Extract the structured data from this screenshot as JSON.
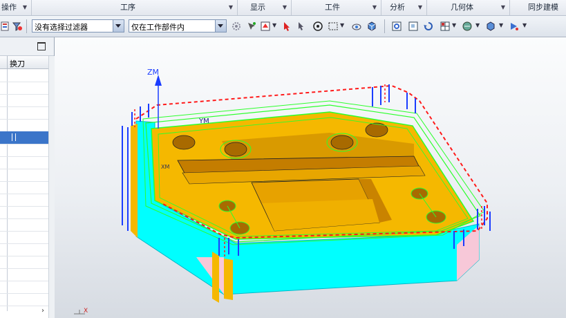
{
  "menubar": {
    "groups": [
      {
        "label": "操作"
      },
      {
        "label": "工序"
      },
      {
        "label": "显示"
      },
      {
        "label": "工件"
      },
      {
        "label": "分析"
      },
      {
        "label": "几何体"
      },
      {
        "label": "同步建模"
      }
    ]
  },
  "toolbar": {
    "filter_selected": "没有选择过滤器",
    "scope_selected": "仅在工作部件内"
  },
  "navigator": {
    "column_header": "换刀",
    "selected_row": 6
  },
  "viewport": {
    "axis_z_label": "ZM",
    "axis_y_label": "YM",
    "axis_x_label": "XM",
    "corner_axis_x": "X",
    "colors": {
      "part_top": "#f5b800",
      "part_side": "#00ffff",
      "toolpath_green": "#2cff2c",
      "boundary_red": "#ff1a1a",
      "tool_blue": "#1a3cff",
      "background": "#eceff3"
    }
  }
}
